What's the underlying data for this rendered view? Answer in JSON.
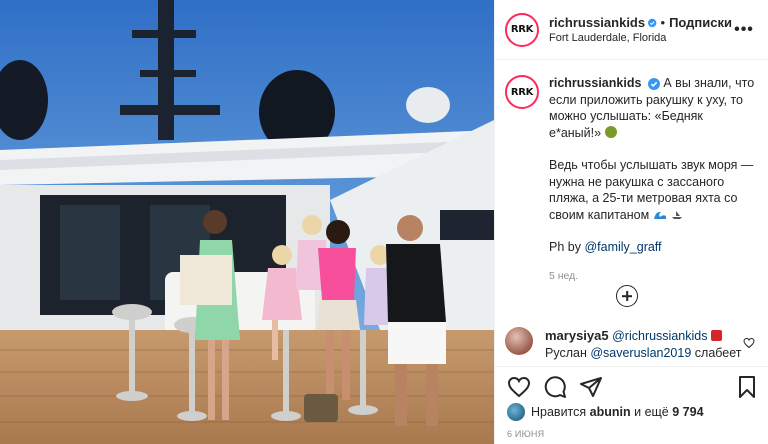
{
  "post": {
    "username": "richrussiankids",
    "follow_label": "Подписки",
    "location": "Fort Lauderdale, Florida",
    "avatar_text": "RRK",
    "more_icon": "more-horizontal-icon"
  },
  "caption": {
    "username": "richrussiankids",
    "line1": "А вы знали, что если приложить ракушку к уху, то можно услышать: «Бедняк е*аный!»",
    "line2": "Ведь чтобы услышать звук моря — нужна не ракушка с зассаного пляжа, а 25-ти метровая яхта со своим капитаном",
    "credit_prefix": "Ph by",
    "credit_link": "@family_graff",
    "time": "5 нед."
  },
  "comment": {
    "username": "marysiya5",
    "mention": "@richrussiankids",
    "line2_prefix": "Руслан",
    "mention2": "@saveruslan2019",
    "line2_suffix": "слабеет"
  },
  "likes": {
    "prefix": "Нравится",
    "user": "abunin",
    "middle": "и ещё",
    "count": "9 794"
  },
  "date": "6 ИЮНЯ",
  "icons": [
    "heart-icon",
    "comment-icon",
    "share-icon",
    "bookmark-icon",
    "load-more-icon",
    "verified-badge-icon"
  ],
  "colors": {
    "text": "#262626",
    "muted": "#8e8e8e",
    "link": "#00376b",
    "verified": "#3897f0",
    "story_ring": "#ff2a56"
  }
}
